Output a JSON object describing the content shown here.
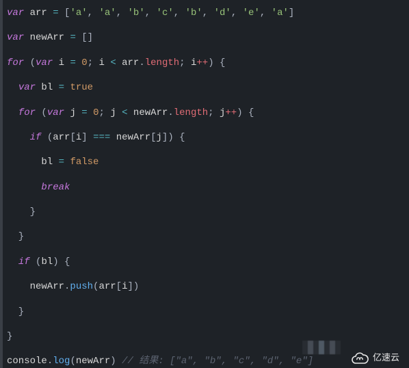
{
  "code": {
    "lines": [
      [
        {
          "c": "kw",
          "t": "var"
        },
        {
          "c": "id",
          "t": " arr "
        },
        {
          "c": "op",
          "t": "="
        },
        {
          "c": "punc",
          "t": " ["
        },
        {
          "c": "str",
          "t": "'a'"
        },
        {
          "c": "punc",
          "t": ", "
        },
        {
          "c": "str",
          "t": "'a'"
        },
        {
          "c": "punc",
          "t": ", "
        },
        {
          "c": "str",
          "t": "'b'"
        },
        {
          "c": "punc",
          "t": ", "
        },
        {
          "c": "str",
          "t": "'c'"
        },
        {
          "c": "punc",
          "t": ", "
        },
        {
          "c": "str",
          "t": "'b'"
        },
        {
          "c": "punc",
          "t": ", "
        },
        {
          "c": "str",
          "t": "'d'"
        },
        {
          "c": "punc",
          "t": ", "
        },
        {
          "c": "str",
          "t": "'e'"
        },
        {
          "c": "punc",
          "t": ", "
        },
        {
          "c": "str",
          "t": "'a'"
        },
        {
          "c": "punc",
          "t": "]"
        }
      ],
      [],
      [
        {
          "c": "kw",
          "t": "var"
        },
        {
          "c": "id",
          "t": " newArr "
        },
        {
          "c": "op",
          "t": "="
        },
        {
          "c": "punc",
          "t": " []"
        }
      ],
      [],
      [
        {
          "c": "kw",
          "t": "for"
        },
        {
          "c": "punc",
          "t": " ("
        },
        {
          "c": "kw",
          "t": "var"
        },
        {
          "c": "id",
          "t": " i "
        },
        {
          "c": "op",
          "t": "="
        },
        {
          "c": "id",
          "t": " "
        },
        {
          "c": "num",
          "t": "0"
        },
        {
          "c": "punc",
          "t": "; "
        },
        {
          "c": "id",
          "t": "i "
        },
        {
          "c": "op",
          "t": "<"
        },
        {
          "c": "id",
          "t": " arr"
        },
        {
          "c": "punc",
          "t": "."
        },
        {
          "c": "prop",
          "t": "length"
        },
        {
          "c": "punc",
          "t": "; "
        },
        {
          "c": "id",
          "t": "i"
        },
        {
          "c": "plus2",
          "t": "++"
        },
        {
          "c": "punc",
          "t": ") {"
        }
      ],
      [],
      [
        {
          "c": "id",
          "t": "  "
        },
        {
          "c": "kw",
          "t": "var"
        },
        {
          "c": "id",
          "t": " bl "
        },
        {
          "c": "op",
          "t": "="
        },
        {
          "c": "id",
          "t": " "
        },
        {
          "c": "bool",
          "t": "true"
        }
      ],
      [],
      [
        {
          "c": "id",
          "t": "  "
        },
        {
          "c": "kw",
          "t": "for"
        },
        {
          "c": "punc",
          "t": " ("
        },
        {
          "c": "kw",
          "t": "var"
        },
        {
          "c": "id",
          "t": " j "
        },
        {
          "c": "op",
          "t": "="
        },
        {
          "c": "id",
          "t": " "
        },
        {
          "c": "num",
          "t": "0"
        },
        {
          "c": "punc",
          "t": "; "
        },
        {
          "c": "id",
          "t": "j "
        },
        {
          "c": "op",
          "t": "<"
        },
        {
          "c": "id",
          "t": " newArr"
        },
        {
          "c": "punc",
          "t": "."
        },
        {
          "c": "prop",
          "t": "length"
        },
        {
          "c": "punc",
          "t": "; "
        },
        {
          "c": "id",
          "t": "j"
        },
        {
          "c": "plus2",
          "t": "++"
        },
        {
          "c": "punc",
          "t": ") {"
        }
      ],
      [],
      [
        {
          "c": "id",
          "t": "    "
        },
        {
          "c": "kw",
          "t": "if"
        },
        {
          "c": "punc",
          "t": " ("
        },
        {
          "c": "id",
          "t": "arr"
        },
        {
          "c": "punc",
          "t": "["
        },
        {
          "c": "id",
          "t": "i"
        },
        {
          "c": "punc",
          "t": "] "
        },
        {
          "c": "op",
          "t": "==="
        },
        {
          "c": "id",
          "t": " newArr"
        },
        {
          "c": "punc",
          "t": "["
        },
        {
          "c": "id",
          "t": "j"
        },
        {
          "c": "punc",
          "t": "]) {"
        }
      ],
      [],
      [
        {
          "c": "id",
          "t": "      bl "
        },
        {
          "c": "op",
          "t": "="
        },
        {
          "c": "id",
          "t": " "
        },
        {
          "c": "bool",
          "t": "false"
        }
      ],
      [],
      [
        {
          "c": "id",
          "t": "      "
        },
        {
          "c": "kw",
          "t": "break"
        }
      ],
      [],
      [
        {
          "c": "punc",
          "t": "    }"
        }
      ],
      [],
      [
        {
          "c": "punc",
          "t": "  }"
        }
      ],
      [],
      [
        {
          "c": "id",
          "t": "  "
        },
        {
          "c": "kw",
          "t": "if"
        },
        {
          "c": "punc",
          "t": " ("
        },
        {
          "c": "id",
          "t": "bl"
        },
        {
          "c": "punc",
          "t": ") {"
        }
      ],
      [],
      [
        {
          "c": "id",
          "t": "    newArr"
        },
        {
          "c": "punc",
          "t": "."
        },
        {
          "c": "fn",
          "t": "push"
        },
        {
          "c": "punc",
          "t": "("
        },
        {
          "c": "id",
          "t": "arr"
        },
        {
          "c": "punc",
          "t": "["
        },
        {
          "c": "id",
          "t": "i"
        },
        {
          "c": "punc",
          "t": "])"
        }
      ],
      [],
      [
        {
          "c": "punc",
          "t": "  }"
        }
      ],
      [],
      [
        {
          "c": "punc",
          "t": "}"
        }
      ],
      [],
      [
        {
          "c": "id",
          "t": "console"
        },
        {
          "c": "punc",
          "t": "."
        },
        {
          "c": "fn",
          "t": "log"
        },
        {
          "c": "punc",
          "t": "("
        },
        {
          "c": "id",
          "t": "newArr"
        },
        {
          "c": "punc",
          "t": ") "
        },
        {
          "c": "cmt",
          "t": "// 结果: [\"a\", \"b\", \"c\", \"d\", \"e\"]"
        }
      ]
    ]
  },
  "watermark": {
    "text": "亿速云"
  }
}
